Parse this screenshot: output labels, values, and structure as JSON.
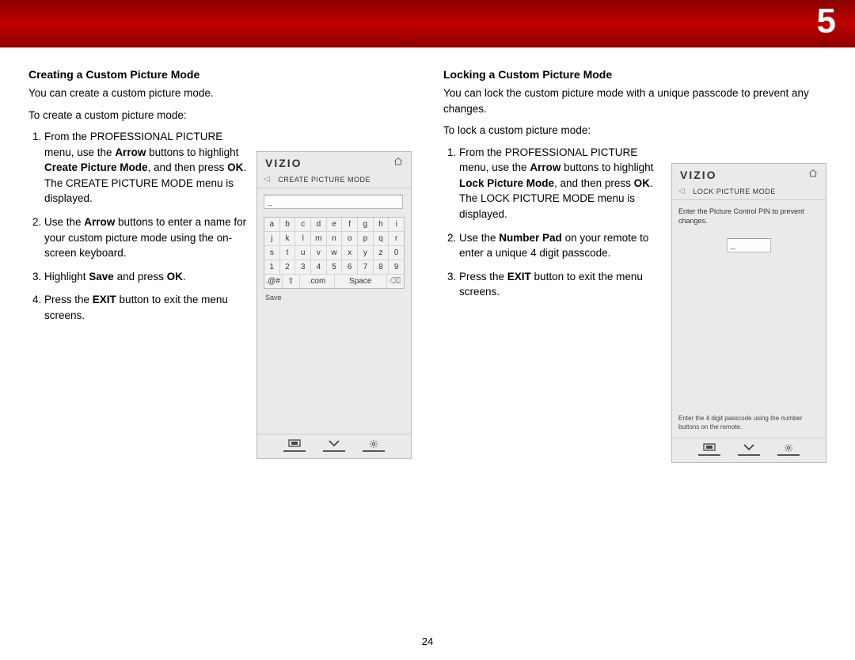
{
  "chapter_number": "5",
  "page_number": "24",
  "left": {
    "heading": "Creating a Custom Picture Mode",
    "p1": "You can create a custom picture mode.",
    "p2": "To create a custom picture mode:",
    "steps": {
      "s1_a": "From the PROFESSIONAL PICTURE menu, use the ",
      "s1_b1": "Arrow",
      "s1_c": " buttons to highlight ",
      "s1_b2": "Create Picture Mode",
      "s1_d": ", and then press ",
      "s1_b3": "OK",
      "s1_e": ". The CREATE PICTURE MODE menu is displayed.",
      "s2_a": "Use the ",
      "s2_b1": "Arrow",
      "s2_b": " buttons to enter a name for your custom picture mode using the on-screen keyboard.",
      "s3_a": "Highlight ",
      "s3_b1": "Save",
      "s3_b": " and press ",
      "s3_b2": "OK",
      "s3_c": ".",
      "s4_a": "Press the ",
      "s4_b1": "EXIT",
      "s4_b": " button to exit the menu screens."
    },
    "device": {
      "logo": "VIZIO",
      "subtitle": "CREATE PICTURE MODE",
      "textfield_value": "_",
      "save_label": "Save",
      "keys_row1": [
        "a",
        "b",
        "c",
        "d",
        "e",
        "f",
        "g",
        "h",
        "i"
      ],
      "keys_row2": [
        "j",
        "k",
        "l",
        "m",
        "n",
        "o",
        "p",
        "q",
        "r"
      ],
      "keys_row3": [
        "s",
        "t",
        "u",
        "v",
        "w",
        "x",
        "y",
        "z",
        "0"
      ],
      "keys_row4": [
        "1",
        "2",
        "3",
        "4",
        "5",
        "6",
        "7",
        "8",
        "9"
      ],
      "keys_row5": {
        "sym": ".@#",
        "shift": "⇧",
        "com": ".com",
        "space": "Space",
        "back": "⌫"
      }
    }
  },
  "right": {
    "heading": "Locking a Custom Picture Mode",
    "p1": "You can lock the custom picture mode with a unique passcode to prevent any changes.",
    "p2": "To lock a custom picture mode:",
    "steps": {
      "s1_a": "From the PROFESSIONAL PICTURE menu, use the ",
      "s1_b1": "Arrow",
      "s1_c": " buttons to highlight ",
      "s1_b2": "Lock Picture Mode",
      "s1_d": ", and then press ",
      "s1_b3": "OK",
      "s1_e": ". The LOCK PICTURE MODE menu is displayed.",
      "s2_a": "Use the ",
      "s2_b1": "Number Pad",
      "s2_b": " on your remote to enter a unique 4 digit passcode.",
      "s3_a": "Press the ",
      "s3_b1": "EXIT",
      "s3_b": " button to exit the menu screens."
    },
    "device": {
      "logo": "VIZIO",
      "subtitle": "LOCK PICTURE MODE",
      "instruction": "Enter the Picture Control PIN to prevent changes.",
      "textfield_value": "_",
      "hint": "Enter the 4 digit passcode using the number buttons on the remote."
    }
  }
}
